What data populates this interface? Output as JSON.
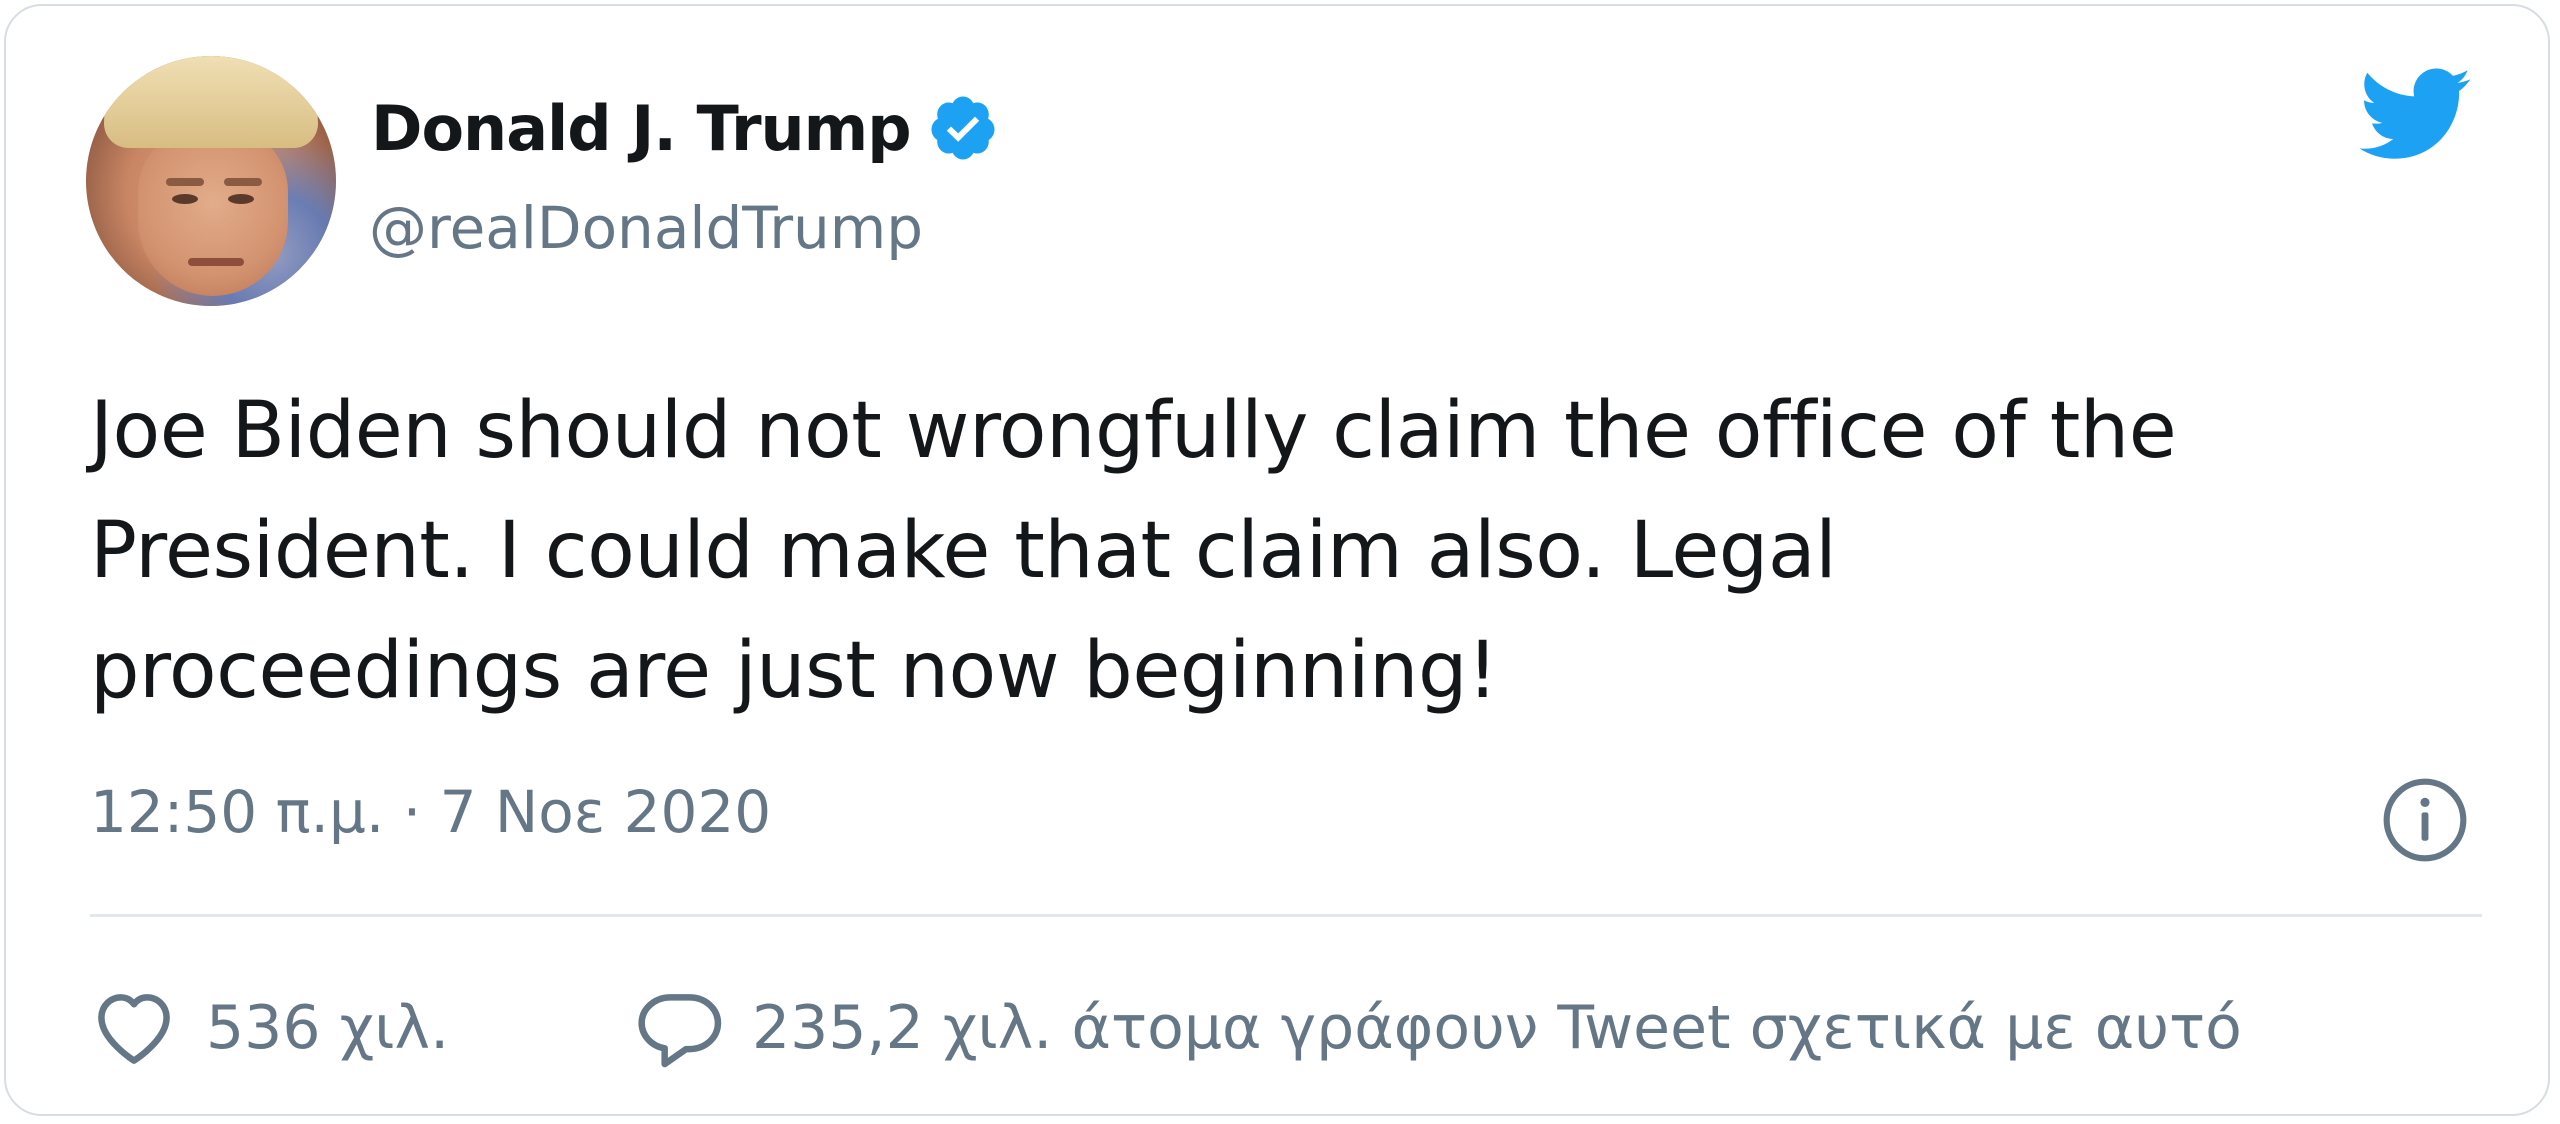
{
  "author": {
    "name": "Donald J. Trump",
    "handle": "@realDonaldTrump",
    "verified": true,
    "avatar_icon": "profile-photo"
  },
  "tweet": {
    "text": "Joe Biden should not wrongfully claim the office of the\nPresident. I could make that claim also. Legal\nproceedings are just now beginning!",
    "timestamp": "12:50 π.μ. · 7 Νοε 2020"
  },
  "actions": {
    "likes_count": "536 χιλ.",
    "replies_text": "235,2 χιλ. άτομα γράφουν Tweet σχετικά με αυτό"
  },
  "icons": {
    "brand": "twitter-bird-icon",
    "verified": "verified-badge-icon",
    "info": "info-icon",
    "like": "heart-icon",
    "reply": "speech-bubble-icon"
  },
  "colors": {
    "twitter_blue": "#1da1f2",
    "text_primary": "#14171a",
    "text_secondary": "#657786",
    "border": "#d6dde3",
    "divider": "#e1e8ed"
  }
}
